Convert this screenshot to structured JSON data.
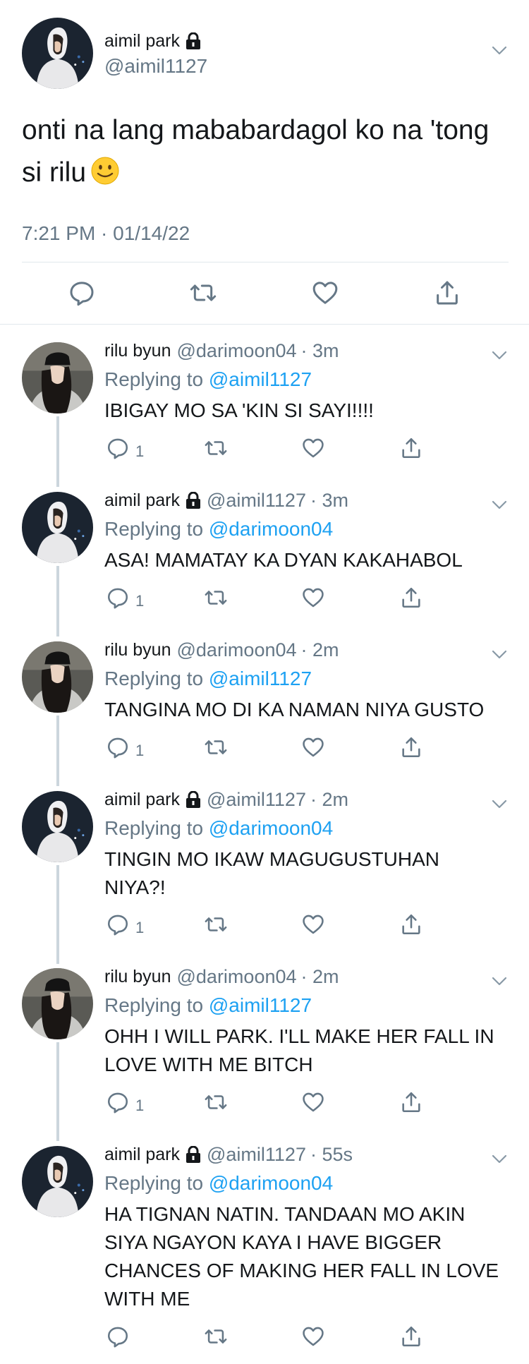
{
  "main": {
    "name": "aimil park",
    "handle": "@aimil1127",
    "text": "onti na lang mababardagol ko na 'tong si rilu",
    "timestamp": "7:21 PM · 01/14/22",
    "emoji": "slightly-smiling-face"
  },
  "replying_label": "Replying to",
  "replies": [
    {
      "name": "rilu byun",
      "handle": "@darimoon04",
      "time": "· 3m",
      "mention": "@aimil1127",
      "text": "IBIGAY MO SA 'KIN SI SAYI!!!!",
      "reply_count": "1"
    },
    {
      "name": "aimil park",
      "handle": "@aimil1127",
      "time": "· 3m",
      "mention": "@darimoon04",
      "text": "ASA! MAMATAY KA DYAN KAKAHABOL",
      "reply_count": "1"
    },
    {
      "name": "rilu byun",
      "handle": "@darimoon04",
      "time": "· 2m",
      "mention": "@aimil1127",
      "text": "TANGINA MO DI KA NAMAN NIYA GUSTO",
      "reply_count": "1"
    },
    {
      "name": "aimil park",
      "handle": "@aimil1127",
      "time": "· 2m",
      "mention": "@darimoon04",
      "text": "TINGIN MO IKAW MAGUGUSTUHAN NIYA?!",
      "reply_count": "1"
    },
    {
      "name": "rilu byun",
      "handle": "@darimoon04",
      "time": "· 2m",
      "mention": "@aimil1127",
      "text": "OHH I WILL PARK. I'LL MAKE HER FALL IN LOVE WITH ME BITCH",
      "reply_count": "1"
    },
    {
      "name": "aimil park",
      "handle": "@aimil1127",
      "time": "· 55s",
      "mention": "@darimoon04",
      "text": "HA TIGNAN NATIN. TANDAAN MO AKIN SIYA NGAYON KAYA I HAVE BIGGER CHANCES OF MAKING HER FALL IN LOVE WITH ME",
      "reply_count": ""
    }
  ],
  "colors": {
    "link": "#1da1f2",
    "secondary": "#657786",
    "text": "#14171a",
    "divider": "#e1e8ed",
    "thread": "#ccd6dd"
  }
}
